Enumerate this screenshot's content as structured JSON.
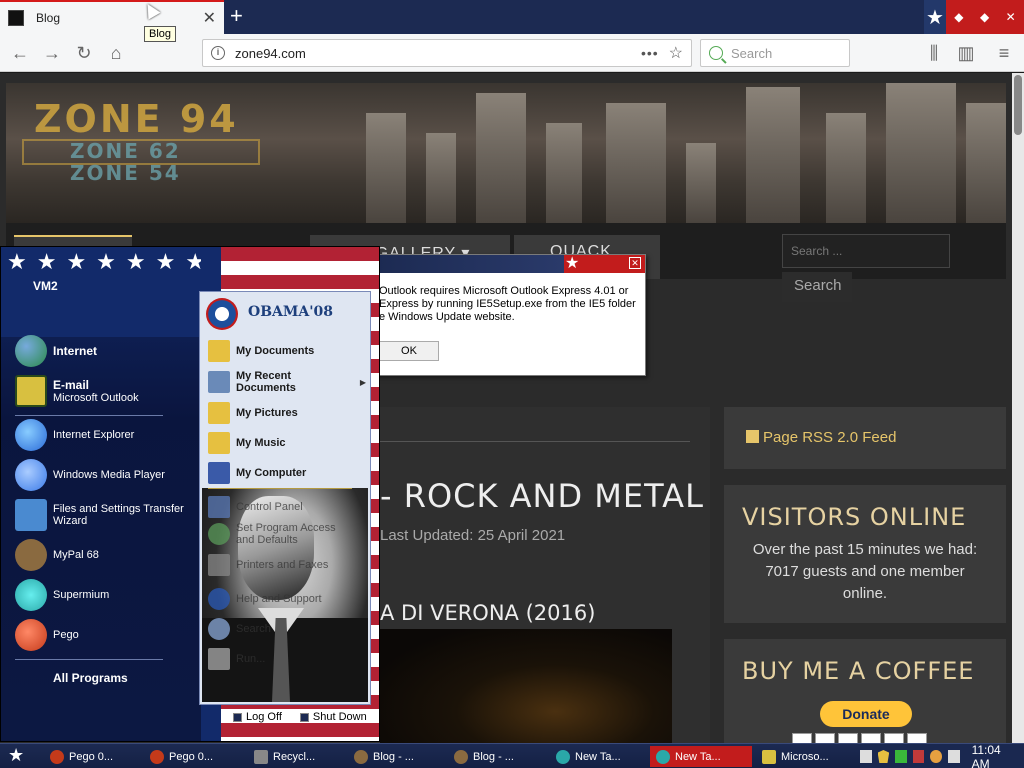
{
  "browser": {
    "tab_title": "Blog",
    "tooltip": "Blog",
    "url": "zone94.com",
    "search_placeholder": "Search"
  },
  "site": {
    "logo_main": "ZONE 94",
    "logo_sub1": "ZONE 62",
    "logo_sub2": "ZONE 54",
    "menu": [
      "",
      "",
      "CE GALLERY ▾",
      "QUACK IT"
    ],
    "search_placeholder": "Search ...",
    "search_button": "Search",
    "main_title": "- ROCK AND METAL",
    "main_updated": "Last Updated: 25 April 2021",
    "main_subtitle": "A DI VERONA (2016)",
    "rss": "Page RSS 2.0 Feed",
    "visitors_title": "VISITORS ONLINE",
    "visitors_text": "Over the past 15 minutes we had: 7017 guests and one member online.",
    "coffee_title": "BUY ME A COFFEE",
    "donate": "Donate"
  },
  "dialog": {
    "message": "Outlook requires Microsoft Outlook Express 4.01 or Express by running IE5Setup.exe from the IE5 folder e Windows Update website.",
    "ok": "OK"
  },
  "startmenu": {
    "user": "VM2",
    "pinned": [
      {
        "title": "Internet",
        "sub": "",
        "color": "#2a8a4a"
      },
      {
        "title": "E-mail",
        "sub": "Microsoft Outlook",
        "color": "#d8c040"
      }
    ],
    "recent": [
      {
        "label": "Internet Explorer",
        "color": "#2a6ad8"
      },
      {
        "label": "Windows Media Player",
        "color": "#3a7ae8"
      },
      {
        "label": "Files and Settings Transfer Wizard",
        "color": "#4a8ad0"
      },
      {
        "label": "MyPal 68",
        "color": "#8a6a40"
      },
      {
        "label": "Supermium",
        "color": "#2aa8a8"
      },
      {
        "label": "Pego",
        "color": "#c43a1a"
      }
    ],
    "all_programs": "All Programs",
    "brand": "OBAMA'08",
    "places": [
      {
        "label": "My Documents",
        "bold": true,
        "arrow": false
      },
      {
        "label": "My Recent Documents",
        "bold": true,
        "arrow": true
      },
      {
        "label": "My Pictures",
        "bold": true,
        "arrow": false
      },
      {
        "label": "My Music",
        "bold": true,
        "arrow": false
      },
      {
        "label": "My Computer",
        "bold": true,
        "arrow": false
      }
    ],
    "system": [
      {
        "label": "Control Panel"
      },
      {
        "label": "Set Program Access and Defaults"
      },
      {
        "label": "Printers and Faxes"
      },
      {
        "label": "Help and Support"
      },
      {
        "label": "Search"
      },
      {
        "label": "Run..."
      }
    ],
    "log_off": "Log Off",
    "shut_down": "Shut Down"
  },
  "taskbar": {
    "buttons": [
      {
        "label": "Pego 0...",
        "active": false,
        "color": "#c43a1a"
      },
      {
        "label": "Pego 0...",
        "active": false,
        "color": "#c43a1a"
      },
      {
        "label": "Recycl...",
        "active": false,
        "color": "#888888"
      },
      {
        "label": "Blog - ...",
        "active": false,
        "color": "#8a6a40"
      },
      {
        "label": "Blog - ...",
        "active": false,
        "color": "#8a6a40"
      },
      {
        "label": "New Ta...",
        "active": false,
        "color": "#2aa8a8"
      },
      {
        "label": "New Ta...",
        "active": true,
        "color": "#2aa8a8"
      },
      {
        "label": "Microso...",
        "active": false,
        "color": "#d8c040"
      }
    ],
    "clock": "11:04 AM"
  },
  "colors": {
    "navy": "#1c2a52",
    "red": "#c21c1c",
    "gold": "#e6c56a"
  }
}
